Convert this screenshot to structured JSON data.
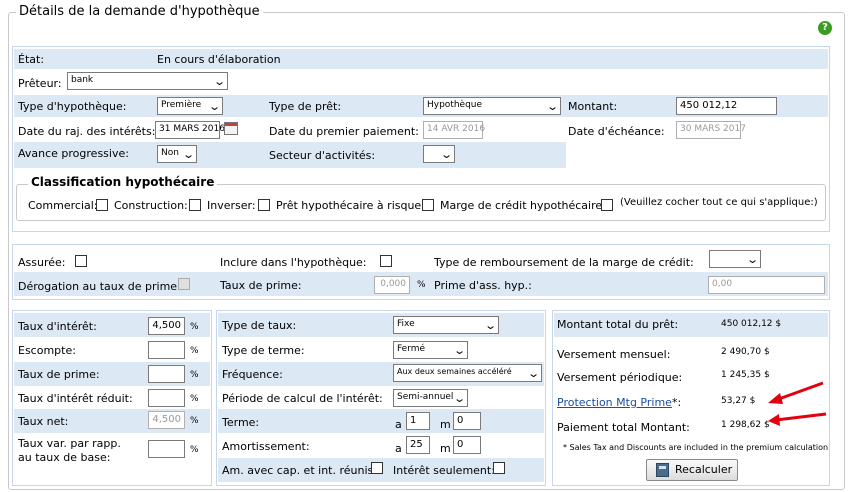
{
  "title": "Détails de la demande d'hypothèque",
  "etat": {
    "label": "État:",
    "value": "En cours d'élaboration"
  },
  "preteur": {
    "label": "Prêteur:",
    "value": "bank"
  },
  "type_hypotheque": {
    "label": "Type d'hypothèque:",
    "value": "Première"
  },
  "type_pret": {
    "label": "Type de prêt:",
    "value": "Hypothèque"
  },
  "montant": {
    "label": "Montant:",
    "value": "450 012,12"
  },
  "date_raj": {
    "label": "Date du raj. des intérêts:",
    "value": "31 MARS 2016"
  },
  "date_premier": {
    "label": "Date du premier paiement:",
    "value": "14 AVR 2016"
  },
  "date_echeance": {
    "label": "Date d'échéance:",
    "value": "30 MARS 2017"
  },
  "avance": {
    "label": "Avance progressive:",
    "value": "Non"
  },
  "secteur": {
    "label": "Secteur d'activités:",
    "value": ""
  },
  "classification": {
    "legend": "Classification hypothécaire",
    "commercial": "Commercial:",
    "construction": "Construction:",
    "inverser": "Inverser:",
    "risque": "Prêt hypothécaire à risque:",
    "marge": "Marge de crédit hypothécaire:",
    "note": "(Veuillez cocher tout ce qui s'applique:)"
  },
  "assurance": {
    "assuree": "Assurée:",
    "inclure": "Inclure dans l'hypothèque:",
    "type_remb": "Type de remboursement de la marge de crédit:",
    "type_remb_value": "",
    "derogation": "Dérogation au taux de prime:",
    "taux_prime_label": "Taux de prime:",
    "taux_prime_value": "0,000",
    "pct": "%",
    "prime_ass": "Prime d'ass. hyp.:",
    "prime_ass_value": "0,00"
  },
  "taux": {
    "interet": {
      "label": "Taux d'intérêt:",
      "value": "4,500"
    },
    "escompte": {
      "label": "Escompte:",
      "value": ""
    },
    "prime": {
      "label": "Taux de prime:",
      "value": ""
    },
    "reduit": {
      "label": "Taux d'intérêt réduit:",
      "value": ""
    },
    "net": {
      "label": "Taux net:",
      "value": "4,500"
    },
    "var_line1": "Taux var. par rapp.",
    "var_line2": "au taux de base:",
    "var_value": "",
    "pct": "%"
  },
  "conditions": {
    "type_taux": {
      "label": "Type de taux:",
      "value": "Fixe"
    },
    "type_terme": {
      "label": "Type de terme:",
      "value": "Fermé"
    },
    "frequence": {
      "label": "Fréquence:",
      "value": "Aux deux semaines accéléré"
    },
    "periode": {
      "label": "Période de calcul de l'intérêt:",
      "value": "Semi-annuel"
    },
    "terme": {
      "label": "Terme:",
      "a": "a",
      "a_value": "1",
      "m": "m",
      "m_value": "0"
    },
    "amort": {
      "label": "Amortissement:",
      "a": "a",
      "a_value": "25",
      "m": "m",
      "m_value": "0"
    },
    "am_cap": "Am. avec cap. et int. réunis:",
    "interet_seul": "Intérêt seulement:"
  },
  "totaux": {
    "montant_total": {
      "label": "Montant total du prêt:",
      "value": "450 012,12 $"
    },
    "mensuel": {
      "label": "Versement mensuel:",
      "value": "2 490,70 $"
    },
    "periodique": {
      "label": "Versement périodique:",
      "value": "1 245,35 $"
    },
    "protection": {
      "label": "Protection Mtg Prime",
      "suffix": "*:",
      "value": "53,27 $"
    },
    "paiement_total": {
      "label": "Paiement total Montant:",
      "value": "1 298,62 $"
    },
    "note": "* Sales Tax and Discounts are included in the premium calculation",
    "recalc": "Recalculer"
  },
  "colors": {
    "row_blue": "#dde8f5",
    "panel_border": "#c6d7ea",
    "arrow_red": "#e3000f",
    "link": "#1b4ea0"
  }
}
